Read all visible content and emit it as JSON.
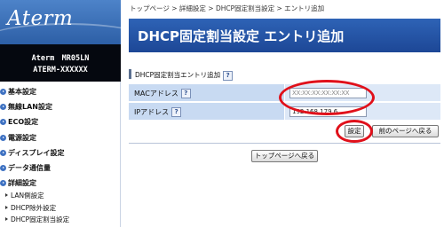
{
  "sidebar": {
    "logo": "Aterm",
    "model_line1": "Aterm　MR05LN",
    "model_line2": "ATERM-XXXXXX",
    "nav": [
      {
        "label": "基本設定"
      },
      {
        "label": "無線LAN設定"
      },
      {
        "label": "ECO設定"
      },
      {
        "label": "電源設定"
      },
      {
        "label": "ディスプレイ設定"
      },
      {
        "label": "データ通信量"
      },
      {
        "label": "詳細設定"
      }
    ],
    "sub_items": [
      {
        "label": "LAN側設定"
      },
      {
        "label": "DHCP除外設定"
      },
      {
        "label": "DHCP固定割当設定"
      }
    ]
  },
  "breadcrumb": "トップページ > 詳細設定 > DHCP固定割当設定 > エントリ追加",
  "page_title": "DHCP固定割当設定 エントリ追加",
  "section": {
    "title": "DHCP固定割当エントリ追加",
    "help_glyph": "?"
  },
  "form": {
    "mac_label": "MACアドレス",
    "mac_value": "XX:XX:XX:XX:XX:XX",
    "ip_label": "IPアドレス",
    "ip_value": "192.168.179.6",
    "help_glyph": "?"
  },
  "buttons": {
    "set": "設定",
    "back": "前のページへ戻る",
    "top": "トップページへ戻る"
  },
  "colors": {
    "banner": "#2e63b6",
    "highlight": "#e0101a",
    "label_cell": "#c8daf2"
  }
}
